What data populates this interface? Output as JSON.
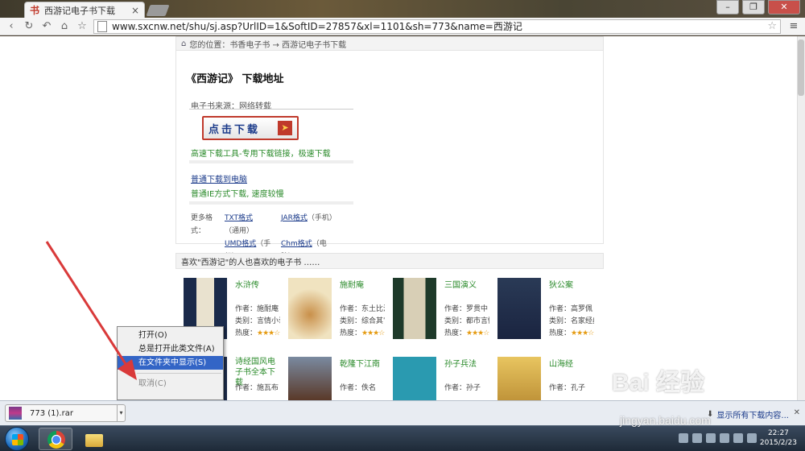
{
  "tab": {
    "title": "西游记电子书下载",
    "favicon": "书"
  },
  "address": {
    "url": "www.sxcnw.net/shu/sj.asp?UrlID=1&SoftID=27857&xl=1101&sh=773&name=西游记"
  },
  "breadcrumb": {
    "text": "您的位置：书香电子书 → 西游记电子书下载"
  },
  "download": {
    "title": "《西游记》 下载地址",
    "source": "电子书来源：网络转载",
    "button_label": "点击下载",
    "fast_note": "高速下载工具-专用下载链接，极速下载",
    "normal_link": "普通下载到电脑",
    "normal_note": "普通IE方式下载, 速度较慢",
    "formats_lead": "更多格式：",
    "formats": [
      {
        "name": "TXT格式",
        "note": "（通用）"
      },
      {
        "name": "JAR格式",
        "note": "（手机）"
      },
      {
        "name": "UMD格式",
        "note": "（手机）"
      },
      {
        "name": "Chm格式",
        "note": "（电脑）"
      }
    ]
  },
  "recommend": {
    "header": "喜欢\"西游记\"的人也喜欢的电子书 ……",
    "books": [
      {
        "name": "水浒传",
        "author": "作者：施耐庵",
        "category": "类别：言情小说",
        "rating_label": "热度：",
        "stars": "★★★☆"
      },
      {
        "name": "施耐庵",
        "author": "作者：东土比江",
        "category": "类别：综合其它",
        "rating_label": "热度：",
        "stars": "★★★☆"
      },
      {
        "name": "三国演义",
        "author": "作者：罗贯中",
        "category": "类别：都市言情",
        "rating_label": "热度：",
        "stars": "★★★☆"
      },
      {
        "name": "狄公案",
        "author": "作者：高罗佩",
        "category": "类别：名家经典",
        "rating_label": "热度：",
        "stars": "★★★☆"
      },
      {
        "name": "诗经国风电子书全本下载",
        "author": "作者：施瓦布",
        "category": "",
        "rating_label": "",
        "stars": ""
      },
      {
        "name": "乾隆下江南",
        "author": "作者：佚名",
        "category": "",
        "rating_label": "",
        "stars": ""
      },
      {
        "name": "孙子兵法",
        "author": "作者：孙子",
        "category": "",
        "rating_label": "",
        "stars": ""
      },
      {
        "name": "山海经",
        "author": "作者：孔子",
        "category": "",
        "rating_label": "",
        "stars": ""
      }
    ]
  },
  "context_menu": {
    "items": [
      {
        "label": "打开(O)"
      },
      {
        "label": "总是打开此类文件(A)"
      },
      {
        "label": "在文件夹中显示(S)"
      },
      {
        "label": "取消(C)"
      }
    ]
  },
  "download_bar": {
    "file_name": "773 (1).rar",
    "show_all": "显示所有下载内容..."
  },
  "clock": {
    "time": "22:27",
    "date": "2015/2/23"
  },
  "watermark": {
    "brand": "Bai 经验",
    "url": "jingyan.baidu.com"
  },
  "colors": {
    "accent": "#3365c6",
    "link": "#1a3a8a",
    "green": "#2a8a2a",
    "red": "#c0392b"
  }
}
